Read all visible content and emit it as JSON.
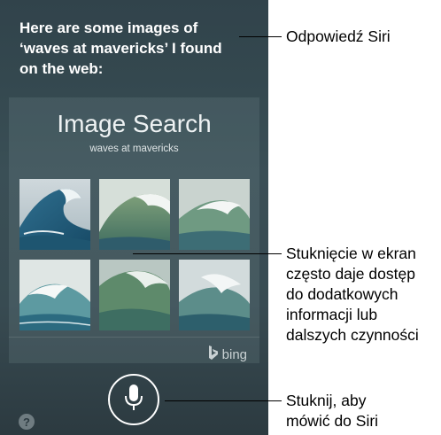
{
  "siri": {
    "response_line1": "Here are some images of",
    "response_line2": "‘waves at mavericks’ I found",
    "response_line3": "on the web:"
  },
  "card": {
    "title": "Image Search",
    "query": "waves at mavericks",
    "provider": "bing",
    "images": [
      {
        "name": "curling-wave-1"
      },
      {
        "name": "green-wave-2"
      },
      {
        "name": "breaking-wave-3"
      },
      {
        "name": "wave-4"
      },
      {
        "name": "big-wave-5"
      },
      {
        "name": "wave-spray-6"
      }
    ]
  },
  "controls": {
    "mic_icon": "microphone-icon",
    "help_label": "?"
  },
  "callouts": {
    "siri_response": "Odpowiedź Siri",
    "tap_screen_1": "Stuknięcie w ekran",
    "tap_screen_2": "często daje dostęp",
    "tap_screen_3": "do dodatkowych",
    "tap_screen_4": "informacji lub",
    "tap_screen_5": "dalszych czynności",
    "tap_mic_1": "Stuknij, aby",
    "tap_mic_2": "mówić do Siri"
  }
}
